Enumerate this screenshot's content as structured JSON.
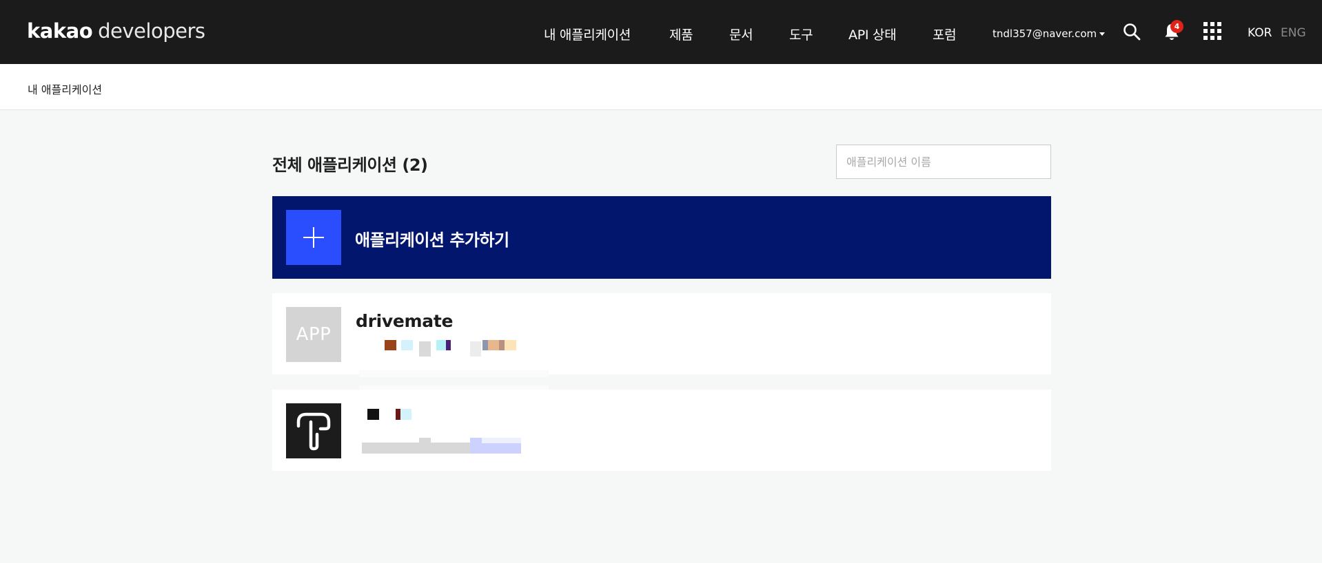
{
  "header": {
    "logo_brand": "kakao",
    "logo_product": "developers",
    "nav": [
      {
        "label": "내 애플리케이션"
      },
      {
        "label": "제품"
      },
      {
        "label": "문서"
      },
      {
        "label": "도구"
      },
      {
        "label": "API 상태"
      },
      {
        "label": "포럼"
      }
    ],
    "account_email": "tndl357@naver.com",
    "notification_count": "4",
    "lang_active": "KOR",
    "lang_inactive": "ENG",
    "icons": [
      "search-icon",
      "bell-icon",
      "apps-grid-icon",
      "caret-down-icon"
    ]
  },
  "breadcrumb": {
    "current": "내 애플리케이션"
  },
  "main": {
    "title": "전체 애플리케이션 (2)",
    "search_placeholder": "애플리케이션 이름",
    "add_button_label": "애플리케이션 추가하기",
    "apps": [
      {
        "name": "drivemate",
        "thumb_text": "APP",
        "thumb_type": "default"
      },
      {
        "name": "",
        "thumb_text": "",
        "thumb_type": "logo-t"
      }
    ]
  },
  "colors": {
    "header_bg": "#1b1b1b",
    "add_card_bg": "#03166d",
    "add_icon_bg": "#2a4dfd",
    "badge": "#e02318",
    "page_bg": "#f6f7f7"
  }
}
